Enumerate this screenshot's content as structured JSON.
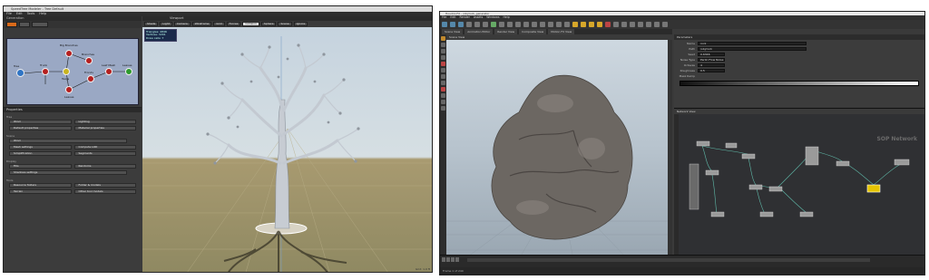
{
  "left_window": {
    "title": "SpeedTree Modeler - Tree Default",
    "menu": [
      "File",
      "Edit",
      "Tools",
      "Help"
    ],
    "generation_editor": {
      "header": "Generation",
      "nodes": [
        {
          "label": "Tree",
          "kind": "root"
        },
        {
          "label": "Trunk",
          "kind": "red"
        },
        {
          "label": "Big Branches",
          "kind": "red"
        },
        {
          "label": "Branches",
          "kind": "red"
        },
        {
          "label": "Twigs",
          "kind": "yellow"
        },
        {
          "label": "Leaves",
          "kind": "red"
        },
        {
          "label": "Fronds",
          "kind": "red"
        },
        {
          "label": "Leaf Mesh",
          "kind": "red"
        },
        {
          "label": "Leaves",
          "kind": "green"
        }
      ]
    },
    "properties": {
      "header": "Properties",
      "sections": [
        {
          "title": "Tree",
          "rows": [
            [
              "Wind",
              "Lighting"
            ],
            [
              "Default properties",
              "Material properties"
            ]
          ]
        },
        {
          "title": "Scene",
          "rows": [
            [
              "Wind"
            ],
            [
              "Mesh settings",
              "Compute LOD"
            ],
            [
              "Simplification",
              "Segments"
            ]
          ]
        },
        {
          "title": "Display",
          "rows": [
            [
              "Fills",
              "Randoms"
            ],
            [
              "Shadows settings"
            ]
          ]
        },
        {
          "title": "Tools",
          "rows": [
            [
              "Resource folders",
              "Folder & models"
            ],
            [
              "Terrain",
              "Other tool models"
            ]
          ]
        }
      ]
    },
    "viewport": {
      "header": "Viewport",
      "toolbar": [
        "Shade",
        "Light",
        "Camera",
        "Wireframe",
        "Grid",
        "Forces",
        "Collision",
        "Sphere",
        "Scene",
        "Ignore"
      ],
      "stats": [
        "Triangles: 4846",
        "Vertices: 3291",
        "Draw calls: 7"
      ],
      "status": "Grid: 1.0 ft"
    }
  },
  "right_window": {
    "title": "Houdini FX - /obj/rock_generator",
    "menu": [
      "File",
      "Edit",
      "Render",
      "Assets",
      "Windows",
      "Help"
    ],
    "tabs": [
      "Scene View",
      "Animation Editor",
      "Render View",
      "Composite View",
      "Motion FX View"
    ],
    "viewport": {
      "header": "Scene View"
    },
    "parameters": {
      "header": "Parameters",
      "rows": [
        {
          "label": "Name",
          "value": "rock"
        },
        {
          "label": "Path",
          "value": "/obj/rock"
        },
        {
          "label": "Seed",
          "value": "0.6346"
        },
        {
          "label": "Noise Type",
          "value": "Perlin Flow Noise"
        },
        {
          "label": "Octaves",
          "value": "4"
        },
        {
          "label": "Roughness",
          "value": "0.5"
        }
      ],
      "ramp_label": "Mask Ramp"
    },
    "network": {
      "header": "Network View",
      "title": "SOP Network"
    },
    "status": "Frame 1 of 240"
  }
}
